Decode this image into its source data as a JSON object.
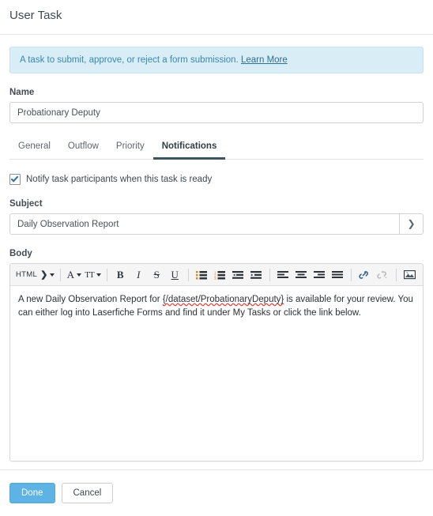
{
  "dialog": {
    "title": "User Task"
  },
  "banner": {
    "text": "A task to submit, approve, or reject a form submission.",
    "link_label": "Learn More",
    "background_color": "#d9edf7",
    "text_color": "#3a87ad"
  },
  "name_field": {
    "label": "Name",
    "value": "Probationary Deputy",
    "placeholder": "Name"
  },
  "tabs": {
    "items": [
      {
        "label": "General",
        "active": false
      },
      {
        "label": "Outflow",
        "active": false
      },
      {
        "label": "Priority",
        "active": false
      },
      {
        "label": "Notifications",
        "active": true
      }
    ],
    "active_underline_color": "#3c5462"
  },
  "notify_checkbox": {
    "label": "Notify task participants when this task is ready",
    "checked": true,
    "check_color": "#2f6ea8"
  },
  "subject_field": {
    "label": "Subject",
    "value": "Daily Observation Report",
    "placeholder": "Subject",
    "chevron_glyph": "❯"
  },
  "body_field": {
    "label": "Body",
    "toolbar": {
      "html_label": "HTML",
      "html_chevron_glyph": "❯",
      "text_color_label": "A",
      "font_size_label": "TT",
      "bold_label": "B",
      "italic_label": "I",
      "strike_label": "S",
      "underline_label": "U"
    },
    "content": {
      "line1_prefix": "A new Daily Observation Report for ",
      "token": "{/dataset/ProbationaryDeputy}",
      "line1_suffix": " is available for your review. You can either log into Laserfiche Forms and find it under My Tasks or click the link below."
    }
  },
  "footer": {
    "done_label": "Done",
    "cancel_label": "Cancel",
    "done_color": "#5cb3e4"
  }
}
